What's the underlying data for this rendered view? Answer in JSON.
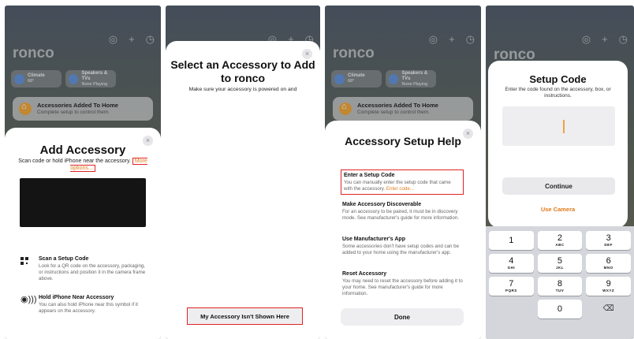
{
  "colors": {
    "accent_orange": "#e07b1a",
    "highlight_red": "#e02424"
  },
  "home": {
    "title": "ronco",
    "chips": [
      {
        "icon": "climate-icon",
        "title": "Climate",
        "sub": "68°"
      },
      {
        "icon": "speaker-icon",
        "title": "Speakers & TVs",
        "sub": "None Playing"
      }
    ],
    "banner_title": "Accessories Added To Home",
    "banner_sub": "Complete setup to control them."
  },
  "panel1": {
    "title": "Add Accessory",
    "subtitle": "Scan code or hold iPhone near the accessory.",
    "more_options": "More options...",
    "options": [
      {
        "icon": "qr-code-icon",
        "title": "Scan a Setup Code",
        "desc": "Look for a QR code on the accessory, packaging, or instructions and position it in the camera frame above."
      },
      {
        "icon": "nfc-icon",
        "title": "Hold iPhone Near Accessory",
        "desc": "You can also hold iPhone near this symbol if it appears on the accessory."
      }
    ]
  },
  "panel2": {
    "title": "Select an Accessory to Add to ronco",
    "subtitle": "Make sure your accessory is powered on and",
    "button": "My Accessory Isn't Shown Here"
  },
  "panel3": {
    "title": "Accessory Setup Help",
    "items": [
      {
        "title": "Enter a Setup Code",
        "desc": "You can manually enter the setup code that came with the accessory.",
        "link": "Enter code..."
      },
      {
        "title": "Make Accessory Discoverable",
        "desc": "For an accessory to be paired, it must be in discovery mode. See manufacturer's guide for more information."
      },
      {
        "title": "Use Manufacturer's App",
        "desc": "Some accessories don't have setup codes and can be added to your home using the manufacturer's app."
      },
      {
        "title": "Reset Accessory",
        "desc": "You may need to reset the accessory before adding it to your home. See manufacturer's guide for more information."
      }
    ],
    "done": "Done"
  },
  "panel4": {
    "title": "Setup Code",
    "subtitle": "Enter the code found on the accessory, box, or instructions.",
    "continue": "Continue",
    "use_camera": "Use Camera",
    "keys": [
      {
        "n": "1",
        "l": ""
      },
      {
        "n": "2",
        "l": "ABC"
      },
      {
        "n": "3",
        "l": "DEF"
      },
      {
        "n": "4",
        "l": "GHI"
      },
      {
        "n": "5",
        "l": "JKL"
      },
      {
        "n": "6",
        "l": "MNO"
      },
      {
        "n": "7",
        "l": "PQRS"
      },
      {
        "n": "8",
        "l": "TUV"
      },
      {
        "n": "9",
        "l": "WXYZ"
      },
      {
        "n": "",
        "l": ""
      },
      {
        "n": "0",
        "l": ""
      },
      {
        "n": "⌫",
        "l": ""
      }
    ]
  },
  "close_glyph": "×",
  "top_icons": [
    "◎",
    "+",
    "◷"
  ]
}
